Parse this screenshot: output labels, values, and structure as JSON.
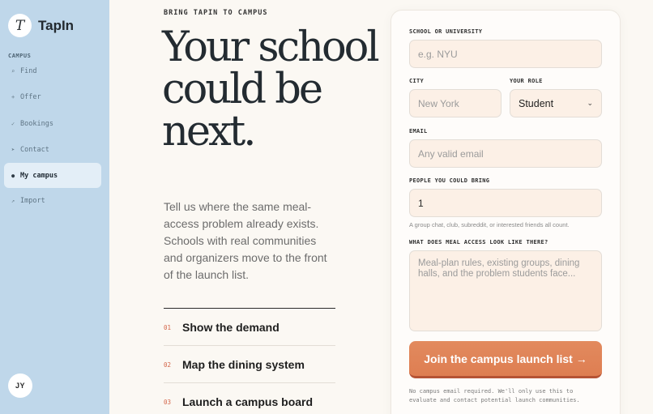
{
  "app": {
    "logo_letter": "T",
    "name": "TapIn"
  },
  "sidebar": {
    "section": "CAMPUS",
    "items": [
      {
        "icon": "search-icon",
        "glyph": "⌕",
        "label": "Find"
      },
      {
        "icon": "plus-icon",
        "glyph": "+",
        "label": "Offer"
      },
      {
        "icon": "check-icon",
        "glyph": "✓",
        "label": "Bookings"
      },
      {
        "icon": "send-icon",
        "glyph": "➤",
        "label": "Contact"
      },
      {
        "icon": "dot-icon",
        "glyph": "●",
        "label": "My campus",
        "active": true
      },
      {
        "icon": "arrow-icon",
        "glyph": "↗",
        "label": "Import"
      }
    ],
    "avatar_initials": "JY"
  },
  "hero": {
    "eyebrow": "BRING TAPIN TO CAMPUS",
    "headline": "Your school could be next.",
    "lead": "Tell us where the same meal-access problem already exists. Schools with real communities and organizers move to the front of the launch list."
  },
  "steps": [
    {
      "num": "01",
      "label": "Show the demand"
    },
    {
      "num": "02",
      "label": "Map the dining system"
    },
    {
      "num": "03",
      "label": "Launch a campus board"
    }
  ],
  "form": {
    "school_label": "SCHOOL OR UNIVERSITY",
    "school_placeholder": "e.g. NYU",
    "city_label": "CITY",
    "city_placeholder": "New York",
    "role_label": "YOUR ROLE",
    "role_value": "Student",
    "email_label": "EMAIL",
    "email_placeholder": "Any valid email",
    "people_label": "PEOPLE YOU COULD BRING",
    "people_value": "1",
    "people_hint": "A group chat, club, subreddit, or interested friends all count.",
    "meal_label": "WHAT DOES MEAL ACCESS LOOK LIKE THERE?",
    "meal_placeholder": "Meal-plan rules, existing groups, dining halls, and the problem students face...",
    "submit_label": "Join the campus launch list →",
    "fine_print": "No campus email required. We'll only use this to evaluate and contact potential launch communities."
  },
  "colors": {
    "sidebar": "#bfd7ea",
    "accent": "#de7e52",
    "background": "#fbf8f3"
  }
}
